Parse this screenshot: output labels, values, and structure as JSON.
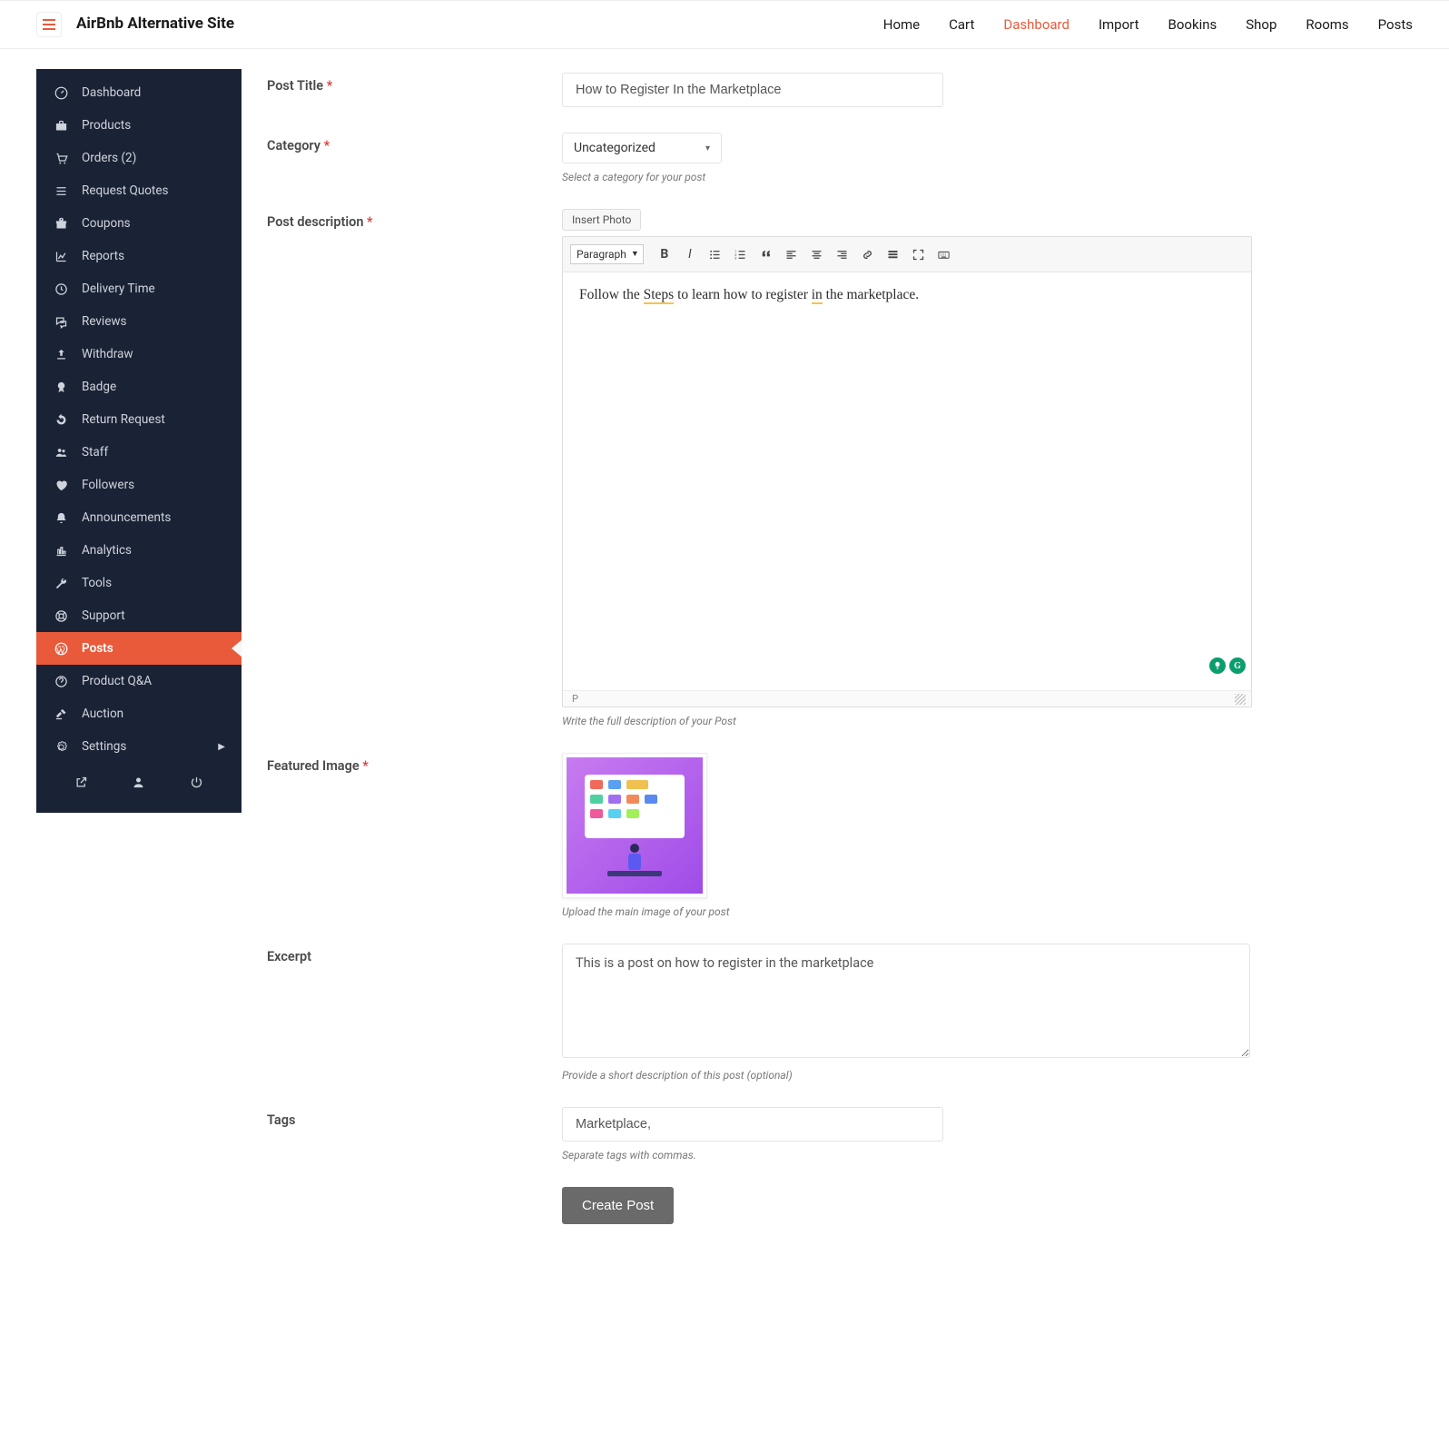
{
  "header": {
    "site_title": "AirBnb Alternative Site"
  },
  "topnav": {
    "items": [
      {
        "label": "Home",
        "active": false
      },
      {
        "label": "Cart",
        "active": false
      },
      {
        "label": "Dashboard",
        "active": true
      },
      {
        "label": "Import",
        "active": false
      },
      {
        "label": "Bookins",
        "active": false
      },
      {
        "label": "Shop",
        "active": false
      },
      {
        "label": "Rooms",
        "active": false
      },
      {
        "label": "Posts",
        "active": false
      }
    ]
  },
  "sidebar": {
    "items": [
      {
        "icon": "dashboard-icon",
        "label": "Dashboard"
      },
      {
        "icon": "briefcase-icon",
        "label": "Products"
      },
      {
        "icon": "cart-icon",
        "label": "Orders (2)"
      },
      {
        "icon": "list-icon",
        "label": "Request Quotes"
      },
      {
        "icon": "gift-icon",
        "label": "Coupons"
      },
      {
        "icon": "chart-icon",
        "label": "Reports"
      },
      {
        "icon": "clock-icon",
        "label": "Delivery Time"
      },
      {
        "icon": "chat-icon",
        "label": "Reviews"
      },
      {
        "icon": "upload-icon",
        "label": "Withdraw"
      },
      {
        "icon": "badge-icon",
        "label": "Badge"
      },
      {
        "icon": "undo-icon",
        "label": "Return Request"
      },
      {
        "icon": "users-icon",
        "label": "Staff"
      },
      {
        "icon": "heart-icon",
        "label": "Followers"
      },
      {
        "icon": "bell-icon",
        "label": "Announcements"
      },
      {
        "icon": "analytics-icon",
        "label": "Analytics"
      },
      {
        "icon": "wrench-icon",
        "label": "Tools"
      },
      {
        "icon": "support-icon",
        "label": "Support"
      },
      {
        "icon": "wordpress-icon",
        "label": "Posts"
      },
      {
        "icon": "question-icon",
        "label": "Product Q&A"
      },
      {
        "icon": "gavel-icon",
        "label": "Auction"
      },
      {
        "icon": "gear-icon",
        "label": "Settings",
        "caret": true
      }
    ],
    "active_index": 17,
    "util_icons": [
      "external-icon",
      "user-icon",
      "power-icon"
    ]
  },
  "form": {
    "post_title": {
      "label": "Post Title",
      "value": "How to Register In the Marketplace"
    },
    "category": {
      "label": "Category",
      "value": "Uncategorized",
      "helper": "Select a category for your post"
    },
    "description": {
      "label": "Post description",
      "insert_photo": "Insert Photo",
      "format_select": "Paragraph",
      "content_prefix": "Follow the ",
      "content_u1": "Steps",
      "content_mid": " to learn how to register ",
      "content_u2": "in",
      "content_suffix": " the marketplace.",
      "status_path": "P",
      "helper": "Write the full description of your Post"
    },
    "featured_image": {
      "label": "Featured Image",
      "helper": "Upload the main image of your post"
    },
    "excerpt": {
      "label": "Excerpt",
      "value": "This is a post on how to register in the marketplace",
      "helper": "Provide a short description of this post (optional)"
    },
    "tags": {
      "label": "Tags",
      "value": "Marketplace,",
      "helper": "Separate tags with commas."
    },
    "submit": {
      "label": "Create Post"
    }
  }
}
